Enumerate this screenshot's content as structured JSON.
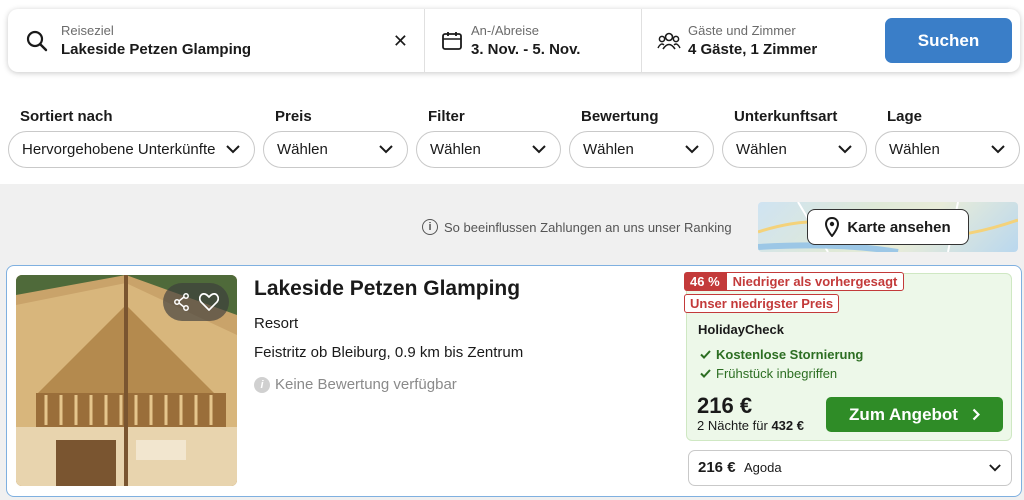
{
  "search": {
    "destination": {
      "label": "Reiseziel",
      "value": "Lakeside Petzen Glamping",
      "icons": [
        "search-icon",
        "close-icon"
      ]
    },
    "dates": {
      "label": "An-/Abreise",
      "value": "3. Nov. - 5. Nov.",
      "icon": "calendar-icon"
    },
    "guests": {
      "label": "Gäste und Zimmer",
      "value": "4 Gäste, 1 Zimmer",
      "icon": "users-icon"
    },
    "button_label": "Suchen",
    "button_color": "#3a7ec8"
  },
  "filters": [
    {
      "label": "Sortiert nach",
      "value": "Hervorgehobene Unterkünfte"
    },
    {
      "label": "Preis",
      "value": "Wählen"
    },
    {
      "label": "Filter",
      "value": "Wählen"
    },
    {
      "label": "Bewertung",
      "value": "Wählen"
    },
    {
      "label": "Unterkunftsart",
      "value": "Wählen"
    },
    {
      "label": "Lage",
      "value": "Wählen"
    }
  ],
  "ranking_notice": "So beeinflussen Zahlungen an uns unser Ranking",
  "map_button": "Karte ansehen",
  "listing": {
    "name": "Lakeside Petzen Glamping",
    "type": "Resort",
    "location": "Feistritz ob Bleiburg, 0.9 km bis Zentrum",
    "rating_text": "Keine Bewertung verfügbar",
    "photo_actions": [
      "share-icon",
      "heart-icon"
    ],
    "deal": {
      "discount": "46 %",
      "discount_text": "Niedriger als vorhergesagt",
      "lowest_price_badge": "Unser niedrigster Preis",
      "provider": "HolidayCheck",
      "perks": [
        "Kostenlose Stornierung",
        "Frühstück inbegriffen"
      ],
      "price": "216 €",
      "nights_text": "2 Nächte für",
      "total": "432 €",
      "cta": "Zum Angebot",
      "accent": "#2f8c27"
    },
    "alternative": {
      "price": "216 €",
      "provider": "Agoda"
    }
  }
}
